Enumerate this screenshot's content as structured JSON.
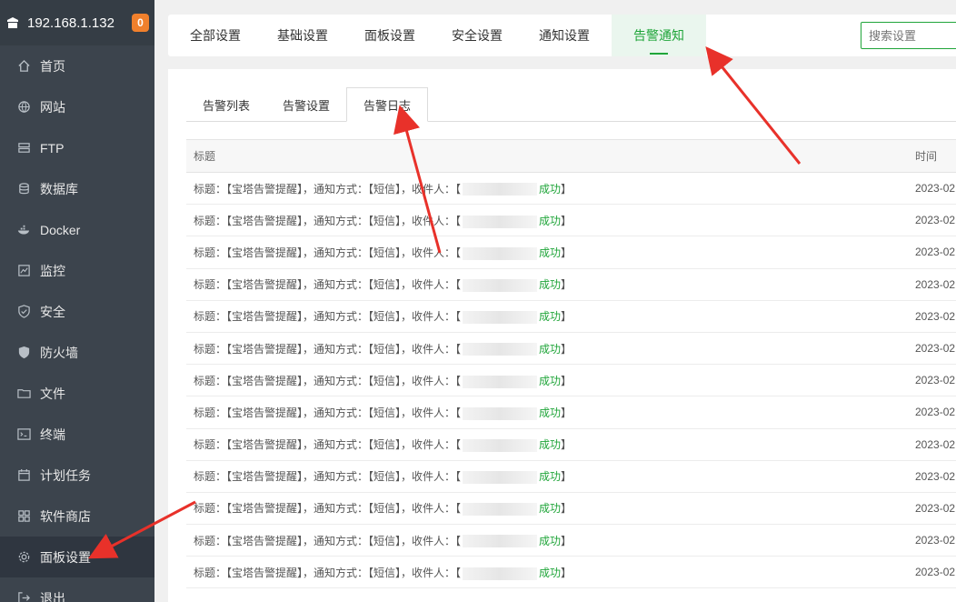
{
  "sidebar": {
    "ip": "192.168.1.132",
    "badge": "0",
    "items": [
      {
        "label": "首页",
        "icon": "home-icon"
      },
      {
        "label": "网站",
        "icon": "globe-icon"
      },
      {
        "label": "FTP",
        "icon": "ftp-icon"
      },
      {
        "label": "数据库",
        "icon": "database-icon"
      },
      {
        "label": "Docker",
        "icon": "docker-icon"
      },
      {
        "label": "监控",
        "icon": "monitor-icon"
      },
      {
        "label": "安全",
        "icon": "shield-icon"
      },
      {
        "label": "防火墙",
        "icon": "firewall-icon"
      },
      {
        "label": "文件",
        "icon": "folder-icon"
      },
      {
        "label": "终端",
        "icon": "terminal-icon"
      },
      {
        "label": "计划任务",
        "icon": "calendar-icon"
      },
      {
        "label": "软件商店",
        "icon": "apps-icon"
      },
      {
        "label": "面板设置",
        "icon": "gear-icon"
      },
      {
        "label": "退出",
        "icon": "logout-icon"
      }
    ]
  },
  "top_tabs": [
    "全部设置",
    "基础设置",
    "面板设置",
    "安全设置",
    "通知设置",
    "告警通知"
  ],
  "search_placeholder": "搜索设置",
  "sub_tabs": [
    "告警列表",
    "告警设置",
    "告警日志"
  ],
  "table": {
    "headers": [
      "标题",
      "时间"
    ],
    "row_prefix": "标题：【宝塔告警提醒】，通知方式：【短信】，收件人：【",
    "row_status": "成功",
    "row_suffix": "】",
    "row_time": "2023-02",
    "rows": 13
  },
  "colors": {
    "accent": "#20a53a",
    "sidebar": "#3c444d",
    "badge": "#f0802c",
    "arrow": "#e8312a"
  }
}
